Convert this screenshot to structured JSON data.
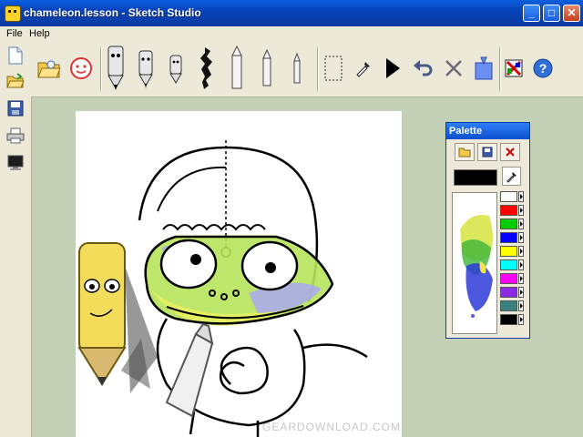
{
  "window": {
    "title": "chameleon.lesson - Sketch Studio"
  },
  "menu": {
    "file": "File",
    "help": "Help"
  },
  "palette": {
    "title": "Palette",
    "current_color": "#000000",
    "swatches": [
      "#ffffff",
      "#ff0000",
      "#00cc00",
      "#0000ff",
      "#ffff00",
      "#00ffff",
      "#ff00ff",
      "#8a2be2",
      "#3a8080",
      "#000000"
    ]
  },
  "watermark": "GEARDOWNLOAD.COM"
}
